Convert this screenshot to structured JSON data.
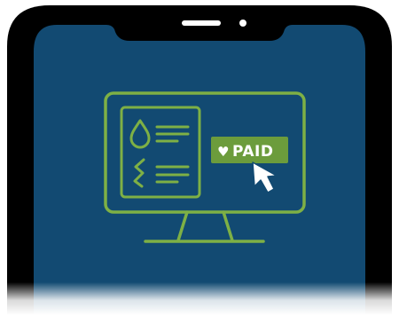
{
  "illustration": {
    "badge_heart": "♥",
    "badge_text": "PAID",
    "icons": [
      "phone-icon",
      "monitor-icon",
      "document-icon",
      "water-drop-icon",
      "lightning-icon",
      "cursor-icon",
      "heart-icon"
    ],
    "colors": {
      "phone_frame": "#000000",
      "screen": "#124a72",
      "line_art": "#7eb045",
      "badge": "#6c9c3c",
      "badge_text": "#ffffff",
      "cursor": "#ffffff"
    }
  }
}
